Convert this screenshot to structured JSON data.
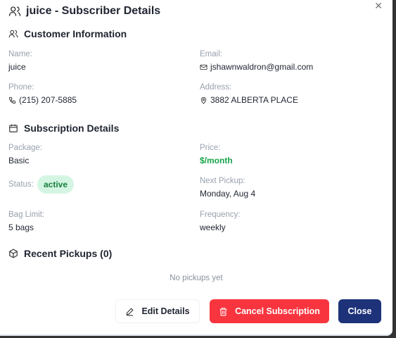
{
  "title": "juice - Subscriber Details",
  "customer": {
    "heading": "Customer Information",
    "name_label": "Name:",
    "name": "juice",
    "email_label": "Email:",
    "email": "jshawnwaldron@gmail.com",
    "phone_label": "Phone:",
    "phone": "(215) 207-5885",
    "address_label": "Address:",
    "address": "3882 ALBERTA PLACE"
  },
  "subscription": {
    "heading": "Subscription Details",
    "package_label": "Package:",
    "package": "Basic",
    "price_label": "Price:",
    "price": "$/month",
    "status_label": "Status:",
    "status": "active",
    "next_label": "Next Pickup:",
    "next": "Monday, Aug 4",
    "bag_label": "Bag Limit:",
    "bag": "5 bags",
    "freq_label": "Frequency:",
    "freq": "weekly"
  },
  "pickups": {
    "heading": "Recent Pickups (0)",
    "empty": "No pickups yet"
  },
  "buttons": {
    "edit": "Edit Details",
    "cancel": "Cancel Subscription",
    "close": "Close"
  },
  "colors": {
    "danger": "#f8353f",
    "primary": "#1d3279",
    "success": "#16a34a"
  }
}
